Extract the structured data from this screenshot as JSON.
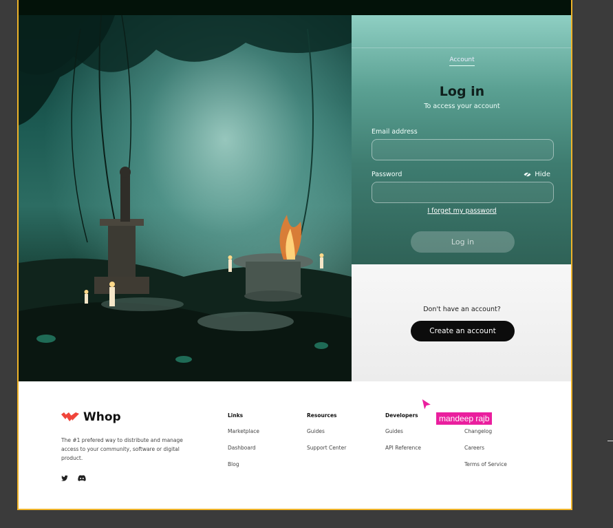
{
  "auth": {
    "tab_label": "Account",
    "title": "Log in",
    "subtitle": "To access your account",
    "email_label": "Email address",
    "email_value": "",
    "password_label": "Password",
    "password_value": "",
    "hide_label": "Hide",
    "forgot_label": "I forget my password",
    "login_button": "Log in"
  },
  "signup": {
    "prompt": "Don't have an account?",
    "create_button": "Create an account"
  },
  "footer": {
    "brand": "Whop",
    "tagline": "The #1 prefered way to distribute and manage access to your community, software or digital product.",
    "columns": [
      {
        "heading": "Links",
        "items": [
          "Marketplace",
          "Dashboard",
          "Blog"
        ]
      },
      {
        "heading": "Resources",
        "items": [
          "Guides",
          "Support Center"
        ]
      },
      {
        "heading": "Developers",
        "items": [
          "Guides",
          "API Reference"
        ]
      },
      {
        "heading": "",
        "items": [
          "Changelog",
          "Careers",
          "Terms of Service"
        ]
      }
    ],
    "social_icons": [
      "twitter-icon",
      "discord-icon"
    ]
  },
  "collaborator": {
    "name": "mandeep rajb",
    "color": "#ea1f9e"
  },
  "colors": {
    "brand": "#f0453b",
    "frame_border": "#f0b429",
    "panel_gradient_top": "#8fcfc3",
    "panel_gradient_bottom": "#2f6257"
  }
}
